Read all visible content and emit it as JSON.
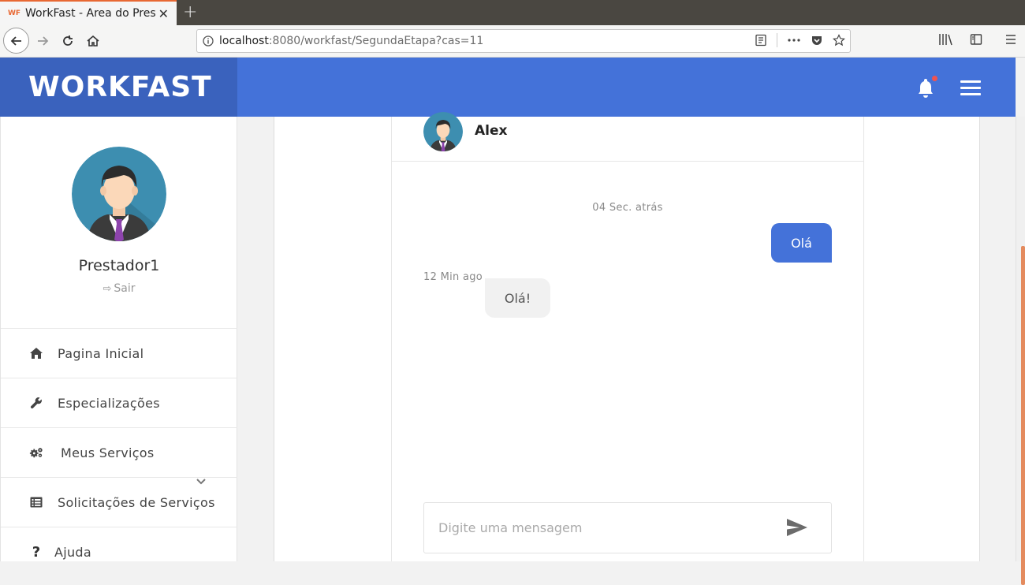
{
  "browser": {
    "tab_title": "WorkFast - Area do Prestador",
    "favicon_text": "WF",
    "url_host": "localhost",
    "url_rest": ":8080/workfast/SegundaEtapa?cas=11"
  },
  "app": {
    "logo": "WORKFAST",
    "accent_color": "#4472d9",
    "notification_dot_color": "#ef5350"
  },
  "sidebar": {
    "profile_name": "Prestador1",
    "logout_label": "Sair",
    "items": [
      {
        "label": "Pagina Inicial",
        "icon": "home-icon"
      },
      {
        "label": "Especializações",
        "icon": "wrench-icon"
      },
      {
        "label": "Meus Serviços",
        "icon": "gears-icon"
      },
      {
        "label": "Solicitações de Serviços",
        "icon": "list-icon"
      },
      {
        "label": "Ajuda",
        "icon": "question-icon"
      }
    ]
  },
  "chat": {
    "contact_name": "Alex",
    "messages": [
      {
        "direction": "outgoing",
        "time": "04 Sec. atrás",
        "text": "Olá"
      },
      {
        "direction": "incoming",
        "time": "12 Min ago",
        "text": "Olá!"
      }
    ],
    "input_placeholder": "Digite uma mensagem"
  }
}
